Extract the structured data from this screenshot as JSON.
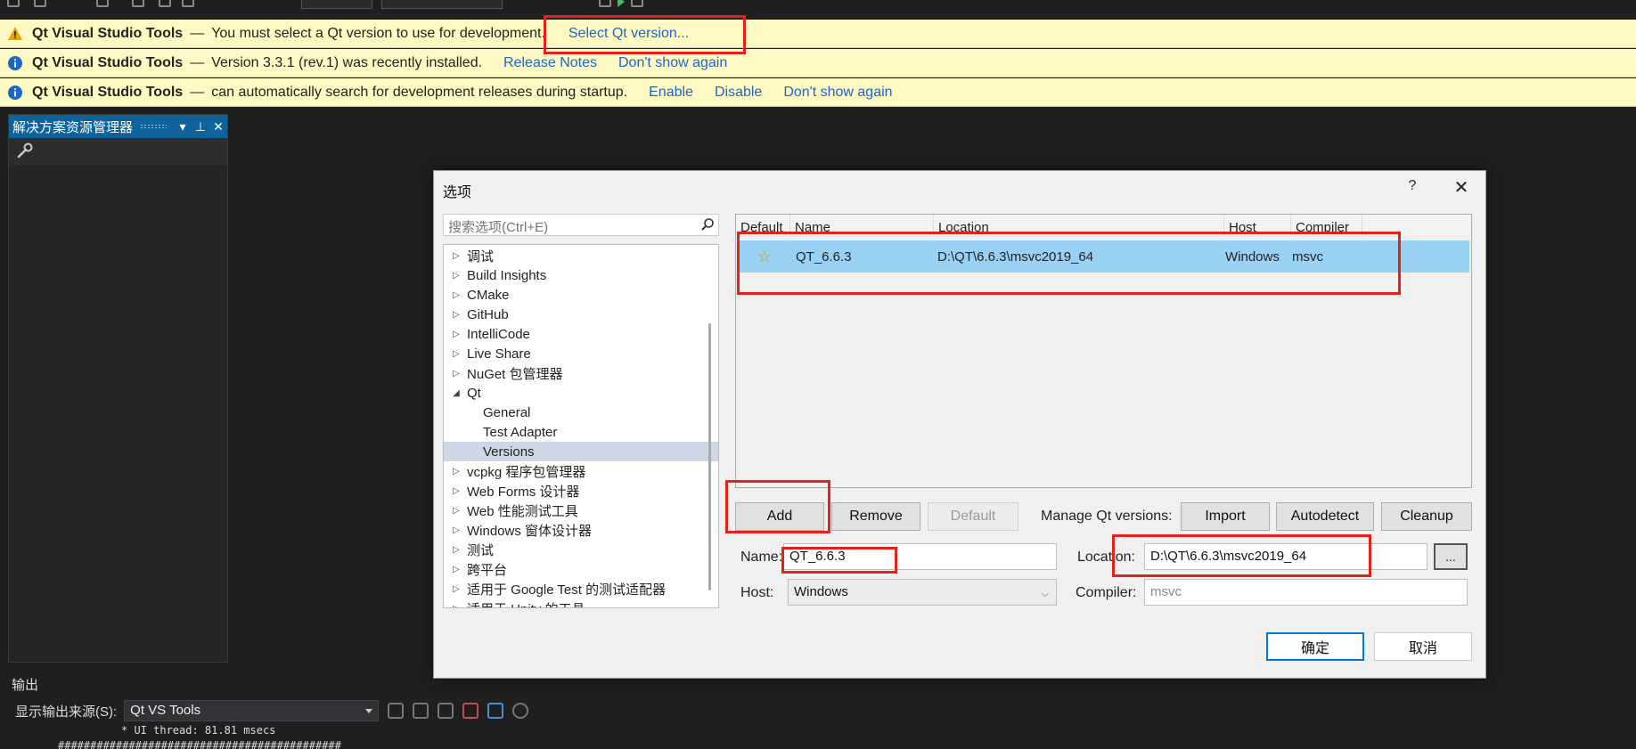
{
  "notifications": [
    {
      "icon": "warning-icon",
      "product": "Qt Visual Studio Tools",
      "dash": "—",
      "message": "You must select a Qt version to use for development.",
      "links": [
        "Select Qt version..."
      ]
    },
    {
      "icon": "info-icon",
      "product": "Qt Visual Studio Tools",
      "dash": "—",
      "message": "Version 3.3.1 (rev.1) was recently installed.",
      "links": [
        "Release Notes",
        "Don't show again"
      ]
    },
    {
      "icon": "info-icon",
      "product": "Qt Visual Studio Tools",
      "dash": "—",
      "message": "can automatically search for development releases during startup.",
      "links": [
        "Enable",
        "Disable",
        "Don't show again"
      ]
    }
  ],
  "solution_explorer": {
    "title": "解决方案资源管理器"
  },
  "dialog": {
    "title": "选项",
    "help": "?",
    "close": "✕",
    "search_placeholder": "搜索选项(Ctrl+E)",
    "tree": [
      {
        "label": "调试",
        "toggle": "▷"
      },
      {
        "label": "Build Insights",
        "toggle": "▷"
      },
      {
        "label": "CMake",
        "toggle": "▷"
      },
      {
        "label": "GitHub",
        "toggle": "▷"
      },
      {
        "label": "IntelliCode",
        "toggle": "▷"
      },
      {
        "label": "Live Share",
        "toggle": "▷"
      },
      {
        "label": "NuGet 包管理器",
        "toggle": "▷"
      },
      {
        "label": "Qt",
        "toggle": "◢"
      },
      {
        "label": "General"
      },
      {
        "label": "Test Adapter"
      },
      {
        "label": "Versions"
      },
      {
        "label": "vcpkg 程序包管理器",
        "toggle": "▷"
      },
      {
        "label": "Web Forms 设计器",
        "toggle": "▷"
      },
      {
        "label": "Web 性能测试工具",
        "toggle": "▷"
      },
      {
        "label": "Windows 窗体设计器",
        "toggle": "▷"
      },
      {
        "label": "测试",
        "toggle": "▷"
      },
      {
        "label": "跨平台",
        "toggle": "▷"
      },
      {
        "label": "适用于 Google Test 的测试适配器",
        "toggle": "▷"
      },
      {
        "label": "适用于 Unity 的工具",
        "toggle": "▷"
      }
    ],
    "selected_tree_item": "Versions",
    "grid": {
      "columns": [
        "Default",
        "Name",
        "Location",
        "Host",
        "Compiler"
      ],
      "rows": [
        {
          "default": "☆",
          "name": "QT_6.6.3",
          "location": "D:\\QT\\6.6.3\\msvc2019_64",
          "host": "Windows",
          "compiler": "msvc"
        }
      ]
    },
    "buttons": {
      "add": "Add",
      "remove": "Remove",
      "default": "Default",
      "manage_label": "Manage Qt versions:",
      "import": "Import",
      "autodetect": "Autodetect",
      "cleanup": "Cleanup",
      "browse": "...",
      "ok": "确定",
      "cancel": "取消"
    },
    "form": {
      "name_label": "Name:",
      "name_value": "QT_6.6.3",
      "location_label": "Location:",
      "location_value": "D:\\QT\\6.6.3\\msvc2019_64",
      "host_label": "Host:",
      "host_value": "Windows",
      "compiler_label": "Compiler:",
      "compiler_value": "msvc"
    }
  },
  "output": {
    "title": "输出",
    "source_label": "显示输出来源(S):",
    "source_value": "Qt VS Tools",
    "lines": [
      "* UI thread: 81.81 msecs",
      "############################################"
    ]
  },
  "colors": {
    "infobar_bg": "#fff9c4",
    "link": "#1a66c9",
    "selection": "#99d1f5",
    "highlight_box": "#e0241c",
    "panel_title": "#0e639c"
  }
}
